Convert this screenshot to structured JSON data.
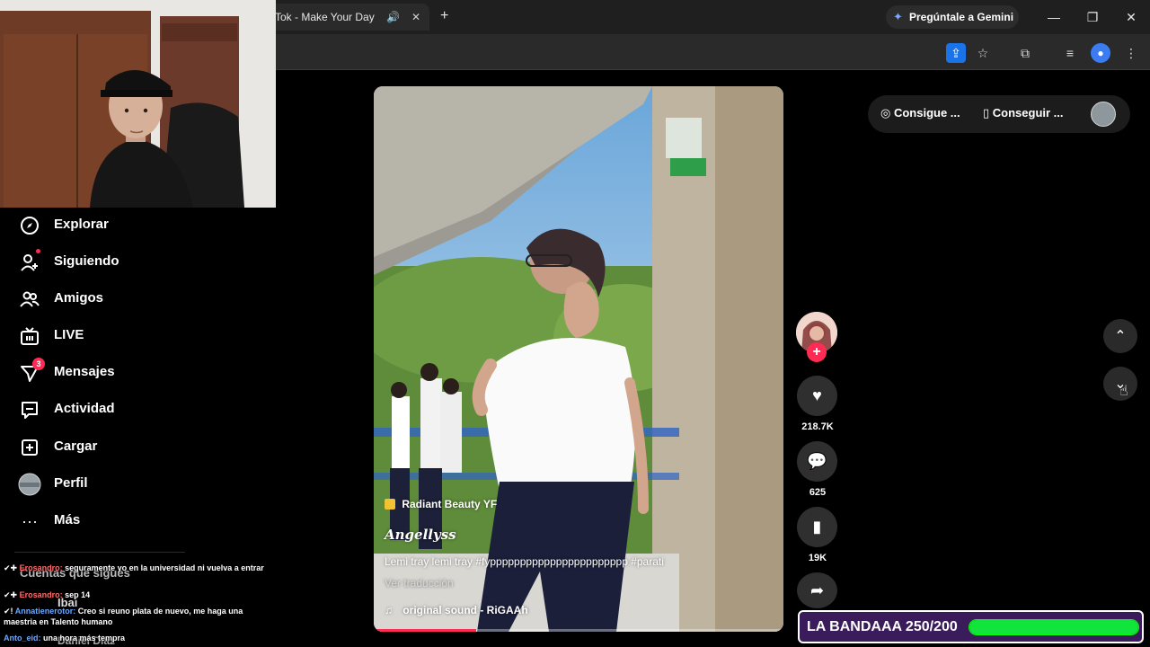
{
  "browser": {
    "tab_title": "Tok - Make Your Day",
    "gemini_label": "Pregúntale a Gemini"
  },
  "sidebar": {
    "items": [
      {
        "label": "Explorar",
        "icon": "compass-icon"
      },
      {
        "label": "Siguiendo",
        "icon": "user-follow-icon"
      },
      {
        "label": "Amigos",
        "icon": "friends-icon"
      },
      {
        "label": "LIVE",
        "icon": "live-tv-icon"
      },
      {
        "label": "Mensajes",
        "icon": "send-icon",
        "badge": "3"
      },
      {
        "label": "Actividad",
        "icon": "activity-icon"
      },
      {
        "label": "Cargar",
        "icon": "upload-icon"
      },
      {
        "label": "Perfil",
        "icon": "avatar"
      },
      {
        "label": "Más",
        "icon": "more-icon"
      }
    ],
    "following_header": "Cuentas que sigues",
    "following": [
      "Ibai",
      "Daniel Díaz"
    ]
  },
  "chat": [
    {
      "user": "Erosandro:",
      "text": "seguramente yo en la universidad ni vuelva a entrar"
    },
    {
      "user": "Erosandro:",
      "text": "sep 14"
    },
    {
      "user": "Annatienerotor:",
      "text": "Creo si reuno plata de nuevo, me haga una maestria en Talento humano"
    },
    {
      "user": "Anto_eid:",
      "text": "una hora más tempra"
    }
  ],
  "video": {
    "effect_label": "Radiant Beauty YF",
    "author": "Angellyss",
    "caption": "Lemi tray lemi tray #fyppppppppppppppppppppppp #parati",
    "translate": "Ver traducción",
    "sound": "original sound - RiGAAh",
    "progress": 0.25,
    "colors": {
      "accent": "#fe2c55"
    }
  },
  "actions": {
    "likes": "218.7K",
    "comments": "625",
    "saves": "19K"
  },
  "top_pills": {
    "coins": "Consigue ...",
    "app": "Conseguir ..."
  },
  "goal": {
    "label": "LA BANDAAA 250/200",
    "progress": 1.0,
    "color": "#11e43a"
  }
}
